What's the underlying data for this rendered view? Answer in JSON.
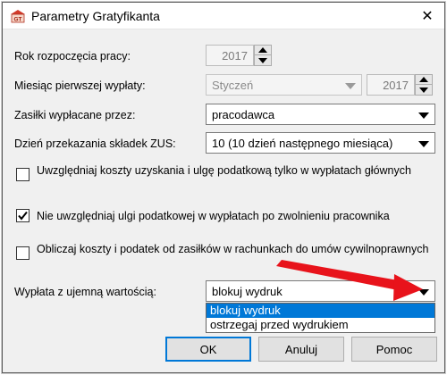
{
  "window": {
    "title": "Parametry Gratyfikanta",
    "close_symbol": "✕",
    "app_icon": "gt-app-icon"
  },
  "fields": {
    "start_year": {
      "label": "Rok rozpoczęcia pracy:",
      "value": "2017"
    },
    "first_payment_month": {
      "label": "Miesiąc pierwszej wypłaty:",
      "month": "Styczeń",
      "year": "2017"
    },
    "benefits_paid_by": {
      "label": "Zasiłki wypłacane przez:",
      "value": "pracodawca"
    },
    "zus_transfer_day": {
      "label": "Dzień przekazania składek ZUS:",
      "value": "10 (10 dzień następnego miesiąca)"
    },
    "negative_payment": {
      "label": "Wypłata z ujemną wartością:",
      "value": "blokuj wydruk"
    }
  },
  "checkboxes": [
    {
      "text": "Uwzględniaj koszty uzyskania i ulgę podatkową tylko w wypłatach głównych",
      "checked": false
    },
    {
      "text": "Nie uwzględniaj ulgi podatkowej w wypłatach po zwolnieniu pracownika",
      "checked": true
    },
    {
      "text": "Obliczaj koszty i podatek od zasiłków w rachunkach do umów cywilnoprawnych",
      "checked": false
    }
  ],
  "dropdown_options": [
    {
      "label": "blokuj wydruk",
      "selected": true
    },
    {
      "label": "ostrzegaj przed wydrukiem",
      "selected": false
    }
  ],
  "buttons": {
    "ok": "OK",
    "cancel": "Anuluj",
    "help": "Pomoc"
  },
  "colors": {
    "selection": "#0078d7",
    "annotation_arrow": "#e8131b"
  }
}
